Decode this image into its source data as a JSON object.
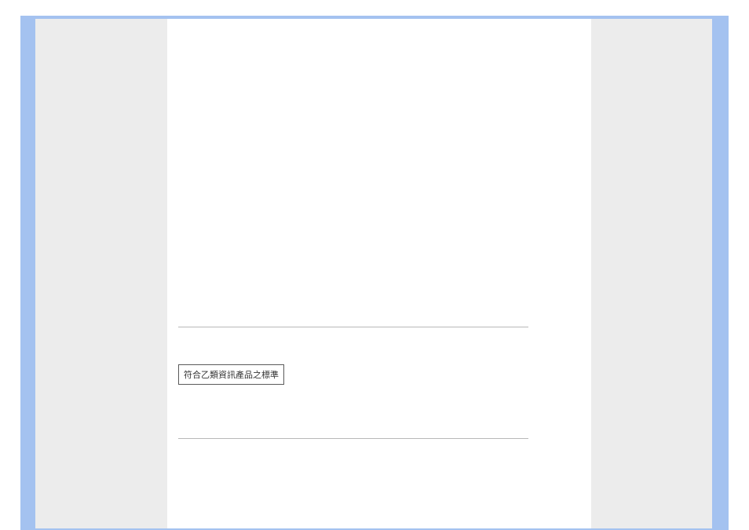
{
  "document": {
    "compliance_label": "符合乙類資訊產品之標準"
  }
}
